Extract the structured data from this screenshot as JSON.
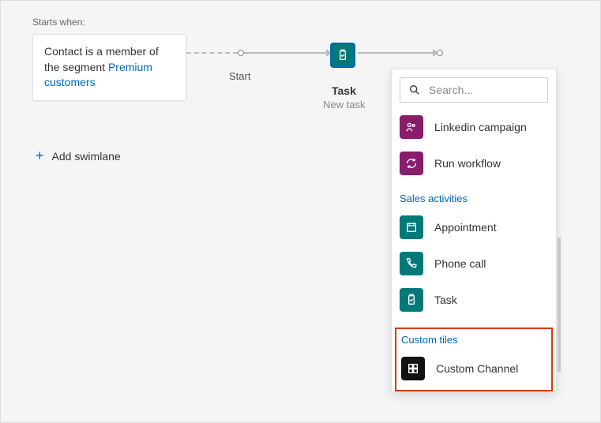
{
  "trigger": {
    "starts_label": "Starts when:",
    "text_prefix": "Contact is a member of the segment ",
    "link_text": "Premium customers"
  },
  "flow": {
    "start_label": "Start",
    "task_label": "Task",
    "task_sub": "New task"
  },
  "add_swimlane": "Add swimlane",
  "panel": {
    "search_placeholder": "Search...",
    "items_top": [
      {
        "label": "Linkedin campaign",
        "color": "purple",
        "icon": "people"
      },
      {
        "label": "Run workflow",
        "color": "purple",
        "icon": "cycle"
      }
    ],
    "sales_header": "Sales activities",
    "sales_items": [
      {
        "label": "Appointment",
        "color": "teal",
        "icon": "calendar"
      },
      {
        "label": "Phone call",
        "color": "teal",
        "icon": "phone"
      },
      {
        "label": "Task",
        "color": "teal",
        "icon": "clipboard"
      }
    ],
    "custom_header": "Custom tiles",
    "custom_items": [
      {
        "label": "Custom Channel",
        "color": "black",
        "icon": "blocks"
      }
    ]
  }
}
